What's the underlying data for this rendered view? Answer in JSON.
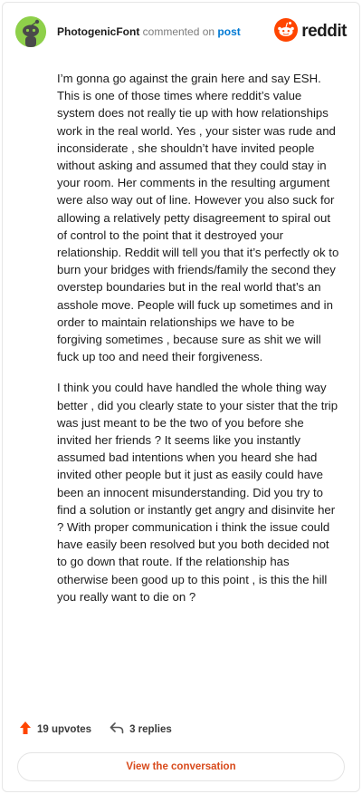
{
  "header": {
    "username": "PhotogenicFont",
    "action_text": "commented on",
    "post_link": "post",
    "brand": "reddit",
    "avatar_icon": "snoo-avatar-icon",
    "logo_icon": "reddit-alien-icon"
  },
  "comment": {
    "paragraphs": [
      "I’m gonna go against the grain here and say ESH. This is one of those times where reddit’s value system does not really tie up with how relationships work in the real world. Yes , your sister was rude and inconsiderate , she shouldn’t have invited people without asking and assumed that they could stay in your room. Her comments in the resulting argument were also way out of line. However you also suck for allowing a relatively petty disagreement to spiral out of control to the point that it destroyed your relationship. Reddit will tell you that it’s perfectly ok to burn your bridges with friends/family the second they overstep boundaries but in the real world that’s an asshole move. People will fuck up sometimes and in order to maintain relationships we have to be forgiving sometimes , because sure as shit we will fuck up too and need their forgiveness.",
      "I think you could have handled the whole thing way better , did you clearly state to your sister that the trip was just meant to be the two of you before she invited her friends ? It seems like you instantly assumed bad intentions when you heard she had invited other people but it just as easily could have been an innocent misunderstanding. Did you try to find a solution or instantly get angry and disinvite her ? With proper communication i think the issue could have easily been resolved but you both decided not to go down that route. If the relationship has otherwise been good up to this point , is this the hill you really want to die on ?"
    ]
  },
  "actions": {
    "upvotes": "19 upvotes",
    "replies": "3 replies",
    "view_conversation": "View the conversation"
  },
  "colors": {
    "accent": "#ff4500",
    "link": "#0079d3",
    "button_text": "#d84a1b",
    "avatar_bg": "#8ed04a"
  }
}
